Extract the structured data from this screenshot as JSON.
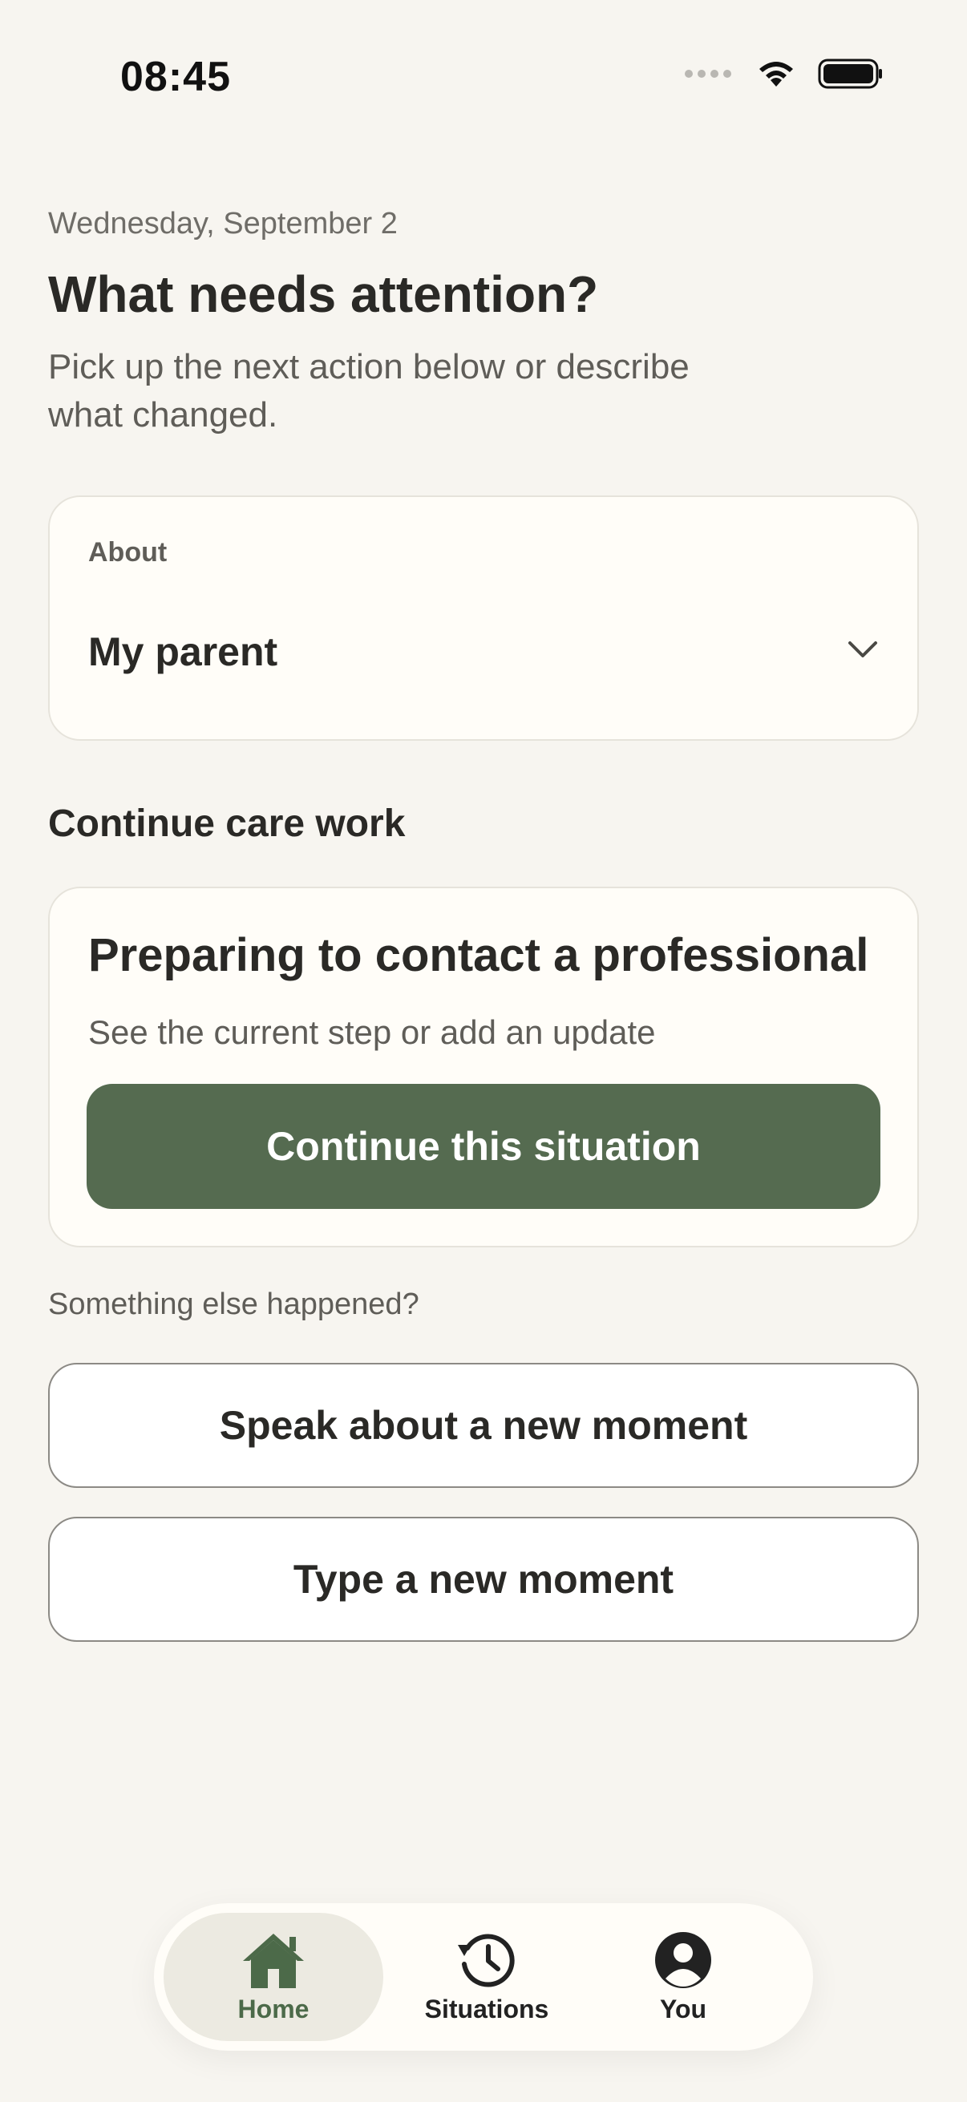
{
  "status_bar": {
    "time": "08:45"
  },
  "header": {
    "date": "Wednesday, September 2",
    "title": "What needs attention?",
    "subtitle": "Pick up the next action below or describe what changed."
  },
  "about": {
    "label": "About",
    "value": "My parent"
  },
  "care_work": {
    "section_title": "Continue care work",
    "card_title": "Preparing to contact a professional",
    "card_description": "See the current step or add an update",
    "button_label": "Continue this situation"
  },
  "new_moment": {
    "label": "Something else happened?",
    "speak_label": "Speak about a new moment",
    "type_label": "Type a new moment"
  },
  "tab_bar": {
    "items": [
      {
        "label": "Home",
        "icon": "home-icon",
        "active": true
      },
      {
        "label": "Situations",
        "icon": "history-icon",
        "active": false
      },
      {
        "label": "You",
        "icon": "user-icon",
        "active": false
      }
    ]
  },
  "colors": {
    "background": "#f7f5f0",
    "accent": "#556b50",
    "active_tab_bg": "#eceae1",
    "card_bg": "#fffdf8"
  }
}
